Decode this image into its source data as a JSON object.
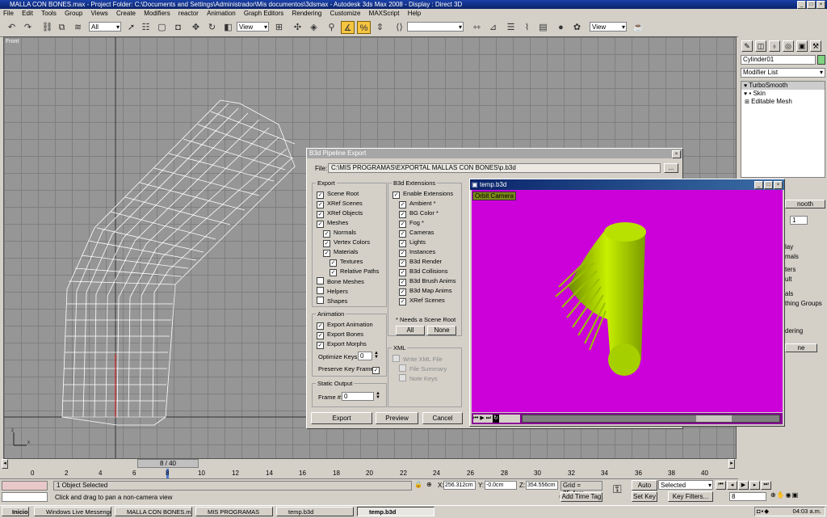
{
  "window": {
    "title": "MALLA CON BONES.max    - Project Folder: C:\\Documents and Settings\\Administrador\\Mis documentos\\3dsmax    - Autodesk 3ds Max 2008     - Display : Direct 3D"
  },
  "menu": [
    "File",
    "Edit",
    "Tools",
    "Group",
    "Views",
    "Create",
    "Modifiers",
    "reactor",
    "Animation",
    "Graph Editors",
    "Rendering",
    "Customize",
    "MAXScript",
    "Help"
  ],
  "toolbar": {
    "selection_filter": "All",
    "ref_coord": "View",
    "view_dropdown2": "View"
  },
  "viewport": {
    "label": "Front"
  },
  "cmdpanel": {
    "object_name": "Cylinder01",
    "modifier_list": "Modifier List",
    "stack": [
      "TurboSmooth",
      "Skin",
      "Editable Mesh"
    ],
    "rollout_title": "nooth",
    "iter_value": "1",
    "frag_lines": [
      "lay",
      "mals",
      "ters",
      "ult",
      "als",
      "thing Groups",
      "dering",
      "ne"
    ]
  },
  "export_dialog": {
    "title": "B3d Pipeline Export",
    "file_label": "File:",
    "file_path": "C:\\MIS PROGRAMAS\\EXPORTAL MALLAS CON BONES\\p.b3d",
    "browse": "...",
    "export_group": "Export",
    "export_items": [
      {
        "label": "Scene Root",
        "checked": true
      },
      {
        "label": "XRef Scenes",
        "checked": true
      },
      {
        "label": "XRef Objects",
        "checked": true
      },
      {
        "label": "Meshes",
        "checked": true
      },
      {
        "label": "Normals",
        "checked": true
      },
      {
        "label": "Vertex Colors",
        "checked": true
      },
      {
        "label": "Materials",
        "checked": true
      },
      {
        "label": "Textures",
        "checked": true
      },
      {
        "label": "Relative Paths",
        "checked": true
      },
      {
        "label": "Bone Meshes",
        "checked": false
      },
      {
        "label": "Helpers",
        "checked": false
      },
      {
        "label": "Shapes",
        "checked": false
      }
    ],
    "ext_group": "B3d Extensions",
    "ext_items": [
      {
        "label": "Enable Extensions",
        "checked": true
      },
      {
        "label": "Ambient *",
        "checked": true
      },
      {
        "label": "BG Color *",
        "checked": true
      },
      {
        "label": "Fog *",
        "checked": true
      },
      {
        "label": "Cameras",
        "checked": true
      },
      {
        "label": "Lights",
        "checked": true
      },
      {
        "label": "Instances",
        "checked": true
      },
      {
        "label": "B3d Render",
        "checked": true
      },
      {
        "label": "B3d Collisions",
        "checked": true
      },
      {
        "label": "B3d Brush Anims",
        "checked": true
      },
      {
        "label": "B3d Map Anims",
        "checked": true
      },
      {
        "label": "XRef Scenes",
        "checked": true
      }
    ],
    "needs_root": "* Needs a Scene Root",
    "all_btn": "All",
    "none_btn": "None",
    "anim_group": "Animation",
    "anim_items": [
      {
        "label": "Export Animation",
        "checked": true
      },
      {
        "label": "Export Bones",
        "checked": true
      },
      {
        "label": "Export Morphs",
        "checked": true
      }
    ],
    "optimize_label": "Optimize Keys:",
    "optimize_value": "0",
    "preserve_label": "Preserve Key Frames:",
    "preserve_checked": true,
    "static_group": "Static Output",
    "frame_label": "Frame #:",
    "frame_value": "0",
    "xml_group": "XML",
    "xml_items": [
      "Write XML File",
      "File Summary",
      "Note Keys"
    ],
    "export_btn": "Export",
    "preview_btn": "Preview",
    "cancel_btn": "Cancel"
  },
  "preview": {
    "title": "temp.b3d",
    "orbit": "Orbit Camera"
  },
  "timeline": {
    "frame_readout": "8 / 40",
    "ticks": [
      "0",
      "2",
      "4",
      "6",
      "8",
      "10",
      "12",
      "14",
      "16",
      "18",
      "20",
      "22",
      "24",
      "26",
      "28",
      "30",
      "32",
      "34",
      "36",
      "38",
      "40"
    ]
  },
  "status": {
    "selected": "1 Object Selected",
    "prompt": "Click and drag to pan a non-camera view",
    "x_label": "X:",
    "x_value": "256.312cm",
    "y_label": "Y:",
    "y_value": "-0.0cm",
    "z_label": "Z:",
    "z_value": "354.556cm",
    "grid": "Grid = 25.4cm",
    "add_time_tag": "Add Time Tag",
    "auto_key": "Auto Key",
    "set_key": "Set Key",
    "selected_dd": "Selected",
    "key_filters": "Key Filters...",
    "frame_field": "8"
  },
  "taskbar": {
    "start": "Inicio",
    "tasks": [
      "Windows Live Messenger",
      "MALLA CON BONES.max ...",
      "MIS PROGRAMAS",
      "temp.b3d",
      "temp.b3d"
    ],
    "clock": "04:03 a.m."
  }
}
